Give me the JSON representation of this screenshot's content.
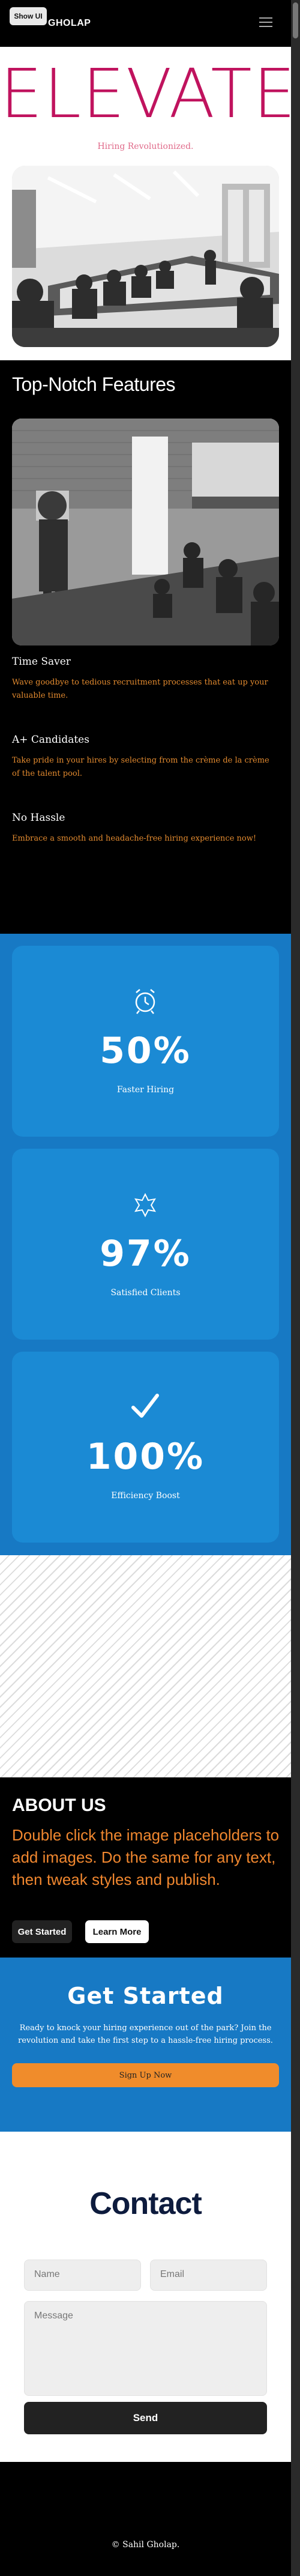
{
  "header": {
    "show_ui_label": "Show UI",
    "brand": "GHOLAP",
    "menu_icon": "hamburger-menu-icon"
  },
  "hero": {
    "title": "ELEVATE",
    "subtitle": "Hiring Revolutionized."
  },
  "features": {
    "title": "Top-Notch Features",
    "items": [
      {
        "title": "Time Saver",
        "description": "Wave goodbye to tedious recruitment processes that eat up your valuable time."
      },
      {
        "title": "A+ Candidates",
        "description": "Take pride in your hires by selecting from the crème de la crème of the talent pool."
      },
      {
        "title": "No Hassle",
        "description": "Embrace a smooth and headache-free hiring experience now!"
      }
    ]
  },
  "stats": [
    {
      "icon": "alarm-clock-icon",
      "value": "50%",
      "label": "Faster Hiring"
    },
    {
      "icon": "sparkle-badge-icon",
      "value": "97%",
      "label": "Satisfied Clients"
    },
    {
      "icon": "checkmark-icon",
      "value": "100%",
      "label": "Efficiency Boost"
    }
  ],
  "about": {
    "title": "ABOUT US",
    "text": "Double click the image placeholders to add images. Do the same for any text, then tweak styles and publish.",
    "get_started_label": "Get Started",
    "learn_more_label": "Learn More"
  },
  "cta": {
    "title": "Get Started",
    "text": "Ready to knock your hiring experience out of the park? Join the revolution and take the first step to a hassle-free hiring process.",
    "button_label": "Sign Up Now"
  },
  "contact": {
    "title": "Contact",
    "name_placeholder": "Name",
    "email_placeholder": "Email",
    "message_placeholder": "Message",
    "send_label": "Send"
  },
  "footer": {
    "text": "© Sahil Gholap."
  },
  "colors": {
    "brand_pink": "#c0135e",
    "accent_orange": "#f08c2b",
    "accent_blue": "#1779c4",
    "dark_navy": "#0d1b3d"
  }
}
